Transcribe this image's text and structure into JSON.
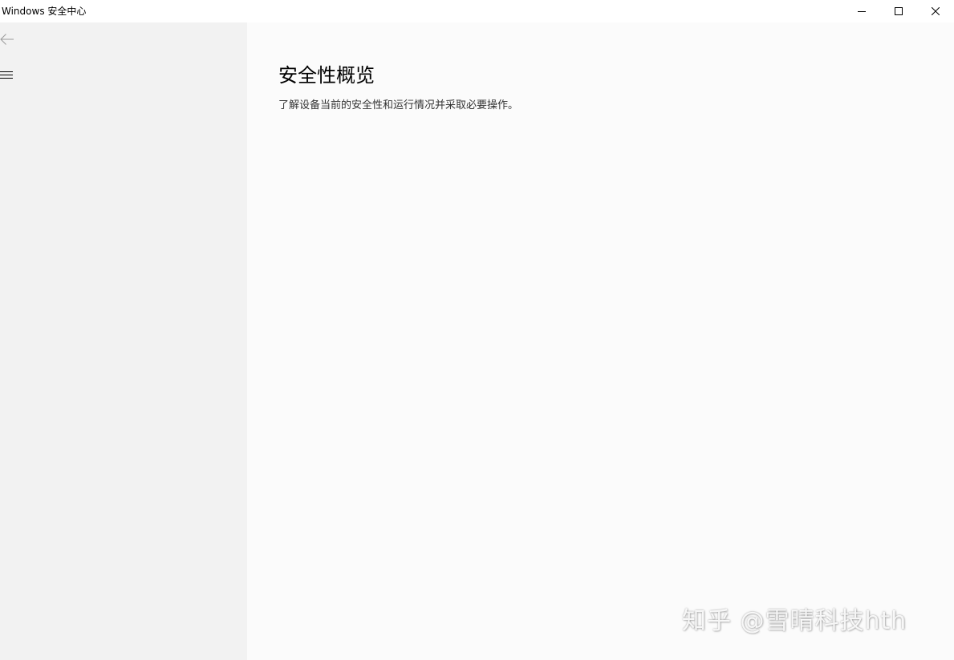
{
  "window": {
    "title": "Windows 安全中心",
    "controls": {
      "minimize_icon": "minimize-icon",
      "maximize_icon": "maximize-icon",
      "close_icon": "close-icon"
    }
  },
  "sidebar": {
    "back_icon": "back-arrow-icon",
    "menu_icon": "hamburger-menu-icon"
  },
  "main": {
    "title": "安全性概览",
    "subtitle": "了解设备当前的安全性和运行情况并采取必要操作。"
  },
  "watermark": {
    "text": "知乎 @雪晴科技hth"
  },
  "colors": {
    "sidebar_bg": "#f2f2f2",
    "main_bg": "#fbfbfb",
    "titlebar_bg": "#ffffff"
  }
}
